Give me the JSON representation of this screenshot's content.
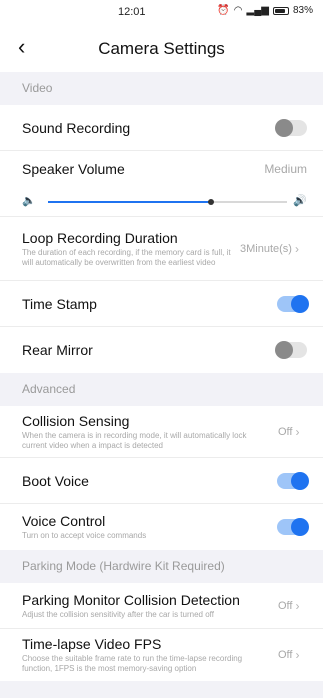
{
  "status": {
    "time": "12:01",
    "battery_text": "83%",
    "battery_level": 0.83
  },
  "header": {
    "title": "Camera Settings",
    "back_icon": "chevron-left-icon"
  },
  "accent_color": "#1f73f0",
  "sections": {
    "video": {
      "label": "Video",
      "sound_recording": {
        "label": "Sound Recording",
        "enabled": false
      },
      "speaker_volume": {
        "label": "Speaker Volume",
        "value": "Medium",
        "level": 0.68
      },
      "loop_recording": {
        "label": "Loop Recording Duration",
        "desc": "The duration of each recording, if the memory card is full, it will automatically be overwritten from the earliest video",
        "value": "3Minute(s)"
      },
      "time_stamp": {
        "label": "Time Stamp",
        "enabled": true
      },
      "rear_mirror": {
        "label": "Rear Mirror",
        "enabled": false
      }
    },
    "advanced": {
      "label": "Advanced",
      "collision_sensing": {
        "label": "Collision Sensing",
        "desc": "When the camera is in recording mode, it will automatically lock current video when a impact is detected",
        "value": "Off"
      },
      "boot_voice": {
        "label": "Boot Voice",
        "enabled": true
      },
      "voice_control": {
        "label": "Voice Control",
        "desc": "Turn on to accept voice commands",
        "enabled": true
      }
    },
    "parking": {
      "label": "Parking Mode (Hardwire Kit Required)",
      "collision_detection": {
        "label": "Parking Monitor Collision Detection",
        "desc": "Adjust the collision sensitivity after the car is turned off",
        "value": "Off"
      },
      "timelapse_fps": {
        "label": "Time-lapse Video FPS",
        "desc": "Choose the suitable frame rate to run the time-lapse recording function, 1FPS is the most memory-saving option",
        "value": "Off"
      }
    }
  }
}
